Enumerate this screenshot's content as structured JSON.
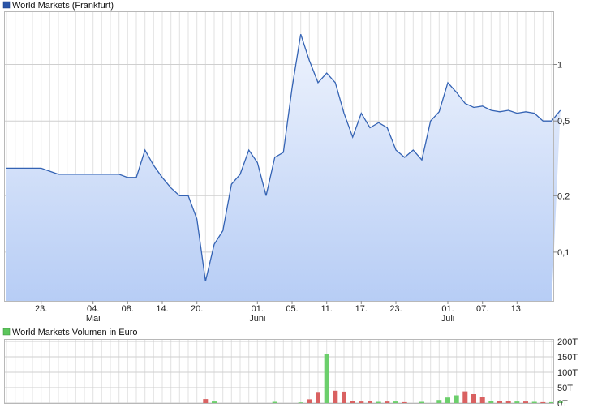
{
  "chart_data": [
    {
      "type": "area",
      "legend": "World Markets (Frankfurt)",
      "colors": {
        "line": "#3463b4",
        "fill_top": "#eef3fd",
        "fill_bottom": "#b7cdf5",
        "legend_swatch": "#2b55a8"
      },
      "y_scale": "log",
      "ylim": [
        0.055,
        1.9
      ],
      "y_ticks": [
        {
          "value": 0.1,
          "label": "0,1"
        },
        {
          "value": 0.2,
          "label": "0,2"
        },
        {
          "value": 0.5,
          "label": "0,5"
        },
        {
          "value": 1,
          "label": "1"
        }
      ],
      "x_ticks": [
        {
          "day": 4,
          "label": "23.",
          "month": ""
        },
        {
          "day": 10,
          "label": "04.",
          "month": "Mai"
        },
        {
          "day": 14,
          "label": "08.",
          "month": ""
        },
        {
          "day": 18,
          "label": "14.",
          "month": ""
        },
        {
          "day": 22,
          "label": "20.",
          "month": ""
        },
        {
          "day": 29,
          "label": "01.",
          "month": "Juni"
        },
        {
          "day": 33,
          "label": "05.",
          "month": ""
        },
        {
          "day": 37,
          "label": "11.",
          "month": ""
        },
        {
          "day": 41,
          "label": "17.",
          "month": ""
        },
        {
          "day": 45,
          "label": "23.",
          "month": ""
        },
        {
          "day": 51,
          "label": "01.",
          "month": "Juli"
        },
        {
          "day": 55,
          "label": "07.",
          "month": ""
        },
        {
          "day": 59,
          "label": "13.",
          "month": ""
        }
      ],
      "x_count": 64,
      "values": [
        0.28,
        0.28,
        0.28,
        0.28,
        0.28,
        0.27,
        0.26,
        0.26,
        0.26,
        0.26,
        0.26,
        0.26,
        0.26,
        0.26,
        0.25,
        0.25,
        0.35,
        0.29,
        0.25,
        0.22,
        0.2,
        0.2,
        0.15,
        0.07,
        0.11,
        0.13,
        0.23,
        0.26,
        0.35,
        0.3,
        0.2,
        0.32,
        0.34,
        0.75,
        1.45,
        1.05,
        0.8,
        0.9,
        0.8,
        0.55,
        0.41,
        0.55,
        0.46,
        0.49,
        0.46,
        0.35,
        0.32,
        0.35,
        0.31,
        0.5,
        0.56,
        0.8,
        0.71,
        0.62,
        0.59,
        0.6,
        0.57,
        0.56,
        0.57,
        0.55,
        0.56,
        0.55,
        0.5,
        0.5,
        0.57
      ]
    },
    {
      "type": "bar",
      "legend": "World Markets Volumen in Euro",
      "colors": {
        "up": "#6ccf6c",
        "down": "#d96161",
        "legend_swatch": "#5cc65c"
      },
      "ylim": [
        0,
        200
      ],
      "y_ticks": [
        {
          "value": 0,
          "label": "0T"
        },
        {
          "value": 50,
          "label": "50T"
        },
        {
          "value": 100,
          "label": "100T"
        },
        {
          "value": 150,
          "label": "150T"
        },
        {
          "value": 200,
          "label": "200T"
        }
      ],
      "x_count": 64,
      "values": [
        0,
        0,
        0,
        0,
        0,
        0,
        0,
        0,
        0,
        0,
        0,
        0,
        0,
        0,
        0,
        0,
        0,
        0,
        0,
        0,
        0,
        0,
        0,
        13,
        5,
        0,
        0,
        0,
        0,
        0,
        0,
        4,
        0,
        0,
        2,
        12,
        36,
        158,
        40,
        37,
        8,
        5,
        7,
        4,
        5,
        5,
        3,
        0,
        4,
        0,
        10,
        18,
        25,
        38,
        29,
        20,
        8,
        7,
        6,
        5,
        5,
        4,
        3,
        3,
        5
      ],
      "directions": [
        "",
        "",
        "",
        "",
        "",
        "",
        "",
        "",
        "",
        "",
        "",
        "",
        "",
        "",
        "",
        "",
        "",
        "",
        "",
        "",
        "",
        "",
        "",
        "down",
        "up",
        "",
        "",
        "",
        "",
        "",
        "",
        "up",
        "",
        "",
        "up",
        "down",
        "down",
        "up",
        "down",
        "down",
        "down",
        "down",
        "down",
        "up",
        "down",
        "up",
        "down",
        "",
        "up",
        "",
        "up",
        "up",
        "up",
        "down",
        "down",
        "down",
        "up",
        "down",
        "down",
        "up",
        "down",
        "up",
        "down",
        "up",
        "up"
      ]
    }
  ]
}
